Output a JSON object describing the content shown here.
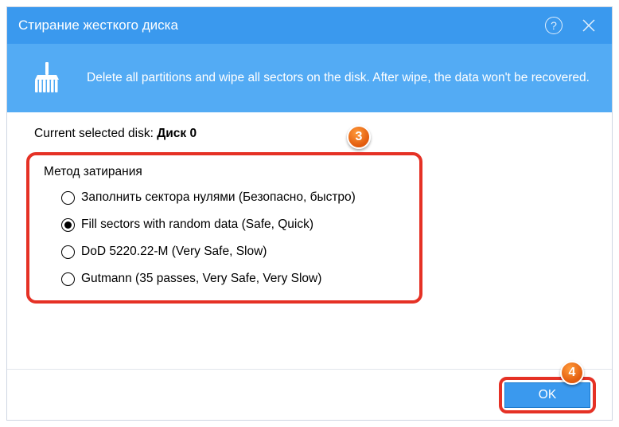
{
  "titlebar": {
    "title": "Стирание жесткого диска"
  },
  "banner": {
    "text": "Delete all partitions and wipe all sectors on the disk. After wipe, the data won't be recovered."
  },
  "selected": {
    "label": "Current selected disk: ",
    "value": "Диск 0"
  },
  "method": {
    "title": "Метод затирания",
    "options": [
      {
        "label": "Заполнить сектора нулями (Безопасно, быстро)",
        "checked": false
      },
      {
        "label": "Fill sectors with random data (Safe, Quick)",
        "checked": true
      },
      {
        "label": "DoD 5220.22-M (Very Safe, Slow)",
        "checked": false
      },
      {
        "label": "Gutmann (35 passes, Very Safe, Very Slow)",
        "checked": false
      }
    ]
  },
  "footer": {
    "ok": "OK"
  },
  "badges": {
    "b3": "3",
    "b4": "4"
  }
}
